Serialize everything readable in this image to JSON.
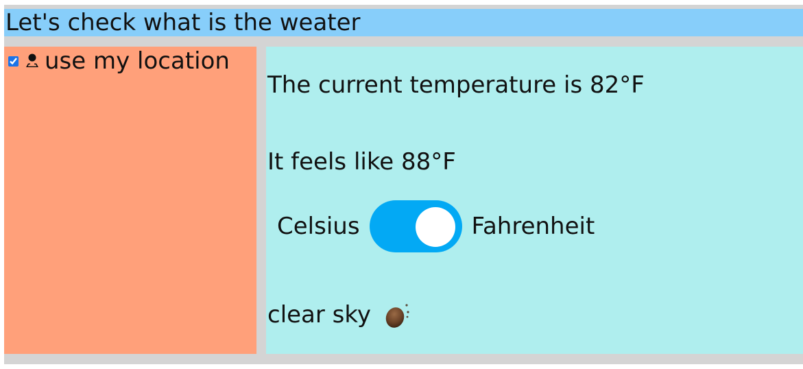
{
  "header": {
    "title": "Let's check what is the weater"
  },
  "sidebar": {
    "use_location_checked": true,
    "use_location_label": "use my location",
    "location_icon": "person-pin-icon"
  },
  "weather": {
    "temperature_text": "The current temperature is  82°F",
    "feels_like_text": "It feels like  88°F",
    "unit_toggle": {
      "left_label": "Celsius",
      "right_label": "Fahrenheit",
      "selected": "Fahrenheit",
      "on": true
    },
    "description": "clear sky",
    "condition_icon": "clear-sky-icon"
  },
  "colors": {
    "page_background": "#d4d4d4",
    "header_background": "#87cefa",
    "sidebar_background": "#ffa07a",
    "main_background": "#afeeee",
    "toggle_on": "#03a9f4",
    "toggle_knob": "#ffffff"
  }
}
